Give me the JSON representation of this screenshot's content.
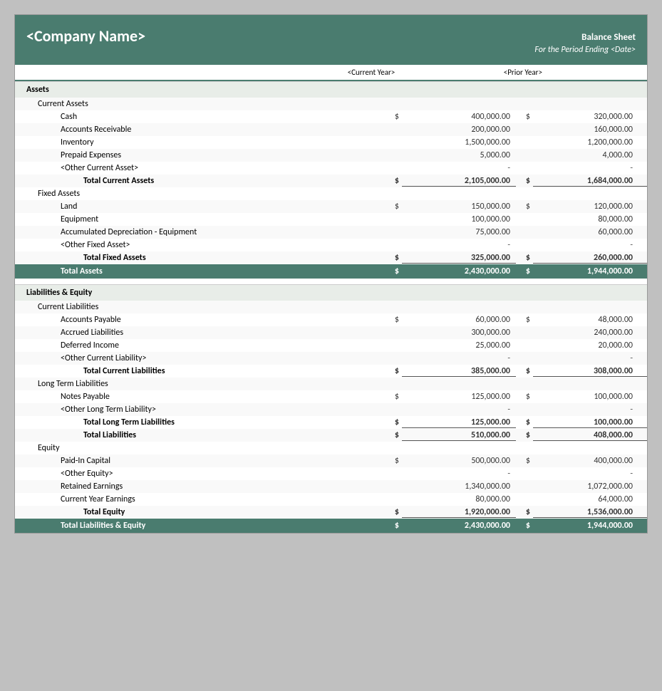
{
  "header": {
    "company": "<Company Name>",
    "title": "Balance Sheet",
    "subtitle": "For the Period Ending <Date>"
  },
  "columns": {
    "current": "<Current Year>",
    "prior": "<Prior Year>"
  },
  "sections": {
    "assets": {
      "label": "Assets",
      "current_assets": {
        "label": "Current Assets",
        "items": [
          {
            "name": "Cash",
            "current": "400,000.00",
            "prior": "320,000.00",
            "show_dollar": true
          },
          {
            "name": "Accounts Receivable",
            "current": "200,000.00",
            "prior": "160,000.00",
            "show_dollar": false
          },
          {
            "name": "Inventory",
            "current": "1,500,000.00",
            "prior": "1,200,000.00",
            "show_dollar": false
          },
          {
            "name": "Prepaid Expenses",
            "current": "5,000.00",
            "prior": "4,000.00",
            "show_dollar": false
          },
          {
            "name": "<Other Current Asset>",
            "current": "-",
            "prior": "-",
            "show_dollar": false
          }
        ],
        "total": {
          "label": "Total Current Assets",
          "current": "2,105,000.00",
          "prior": "1,684,000.00"
        }
      },
      "fixed_assets": {
        "label": "Fixed Assets",
        "items": [
          {
            "name": "Land",
            "current": "150,000.00",
            "prior": "120,000.00",
            "show_dollar": true
          },
          {
            "name": "Equipment",
            "current": "100,000.00",
            "prior": "80,000.00",
            "show_dollar": false
          },
          {
            "name": "Accumulated Depreciation - Equipment",
            "current": "75,000.00",
            "prior": "60,000.00",
            "show_dollar": false
          },
          {
            "name": "<Other Fixed Asset>",
            "current": "-",
            "prior": "-",
            "show_dollar": false
          }
        ],
        "total": {
          "label": "Total Fixed Assets",
          "current": "325,000.00",
          "prior": "260,000.00"
        }
      },
      "grand_total": {
        "label": "Total Assets",
        "current": "2,430,000.00",
        "prior": "1,944,000.00"
      }
    },
    "liabilities_equity": {
      "label": "Liabilities & Equity",
      "current_liabilities": {
        "label": "Current Liabilities",
        "items": [
          {
            "name": "Accounts Payable",
            "current": "60,000.00",
            "prior": "48,000.00",
            "show_dollar": true
          },
          {
            "name": "Accrued Liabilities",
            "current": "300,000.00",
            "prior": "240,000.00",
            "show_dollar": false
          },
          {
            "name": "Deferred Income",
            "current": "25,000.00",
            "prior": "20,000.00",
            "show_dollar": false
          },
          {
            "name": "<Other Current Liability>",
            "current": "-",
            "prior": "-",
            "show_dollar": false
          }
        ],
        "total": {
          "label": "Total Current Liabilities",
          "current": "385,000.00",
          "prior": "308,000.00"
        }
      },
      "long_term_liabilities": {
        "label": "Long Term Liabilities",
        "items": [
          {
            "name": "Notes Payable",
            "current": "125,000.00",
            "prior": "100,000.00",
            "show_dollar": true
          },
          {
            "name": "<Other Long Term Liability>",
            "current": "-",
            "prior": "-",
            "show_dollar": false
          }
        ],
        "total_lt": {
          "label": "Total Long Term Liabilities",
          "current": "125,000.00",
          "prior": "100,000.00"
        },
        "total_liabilities": {
          "label": "Total Liabilities",
          "current": "510,000.00",
          "prior": "408,000.00"
        }
      },
      "equity": {
        "label": "Equity",
        "items": [
          {
            "name": "Paid-In Capital",
            "current": "500,000.00",
            "prior": "400,000.00",
            "show_dollar": true
          },
          {
            "name": "<Other Equity>",
            "current": "-",
            "prior": "-",
            "show_dollar": false
          },
          {
            "name": "Retained Earnings",
            "current": "1,340,000.00",
            "prior": "1,072,000.00",
            "show_dollar": false
          },
          {
            "name": "Current Year Earnings",
            "current": "80,000.00",
            "prior": "64,000.00",
            "show_dollar": false
          }
        ],
        "total_equity": {
          "label": "Total Equity",
          "current": "1,920,000.00",
          "prior": "1,536,000.00"
        },
        "grand_total": {
          "label": "Total Liabilities & Equity",
          "current": "2,430,000.00",
          "prior": "1,944,000.00"
        }
      }
    }
  }
}
